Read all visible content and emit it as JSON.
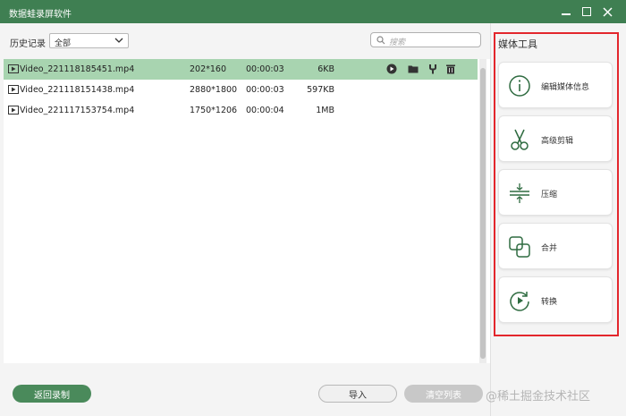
{
  "window": {
    "title": "数据蛙录屏软件"
  },
  "toolbar": {
    "history_label": "历史记录",
    "filter_value": "全部",
    "search_placeholder": "搜索"
  },
  "files": [
    {
      "name": "Video_221118185451.mp4",
      "resolution": "202*160",
      "duration": "00:00:03",
      "size": "6KB",
      "selected": true
    },
    {
      "name": "Video_221118151438.mp4",
      "resolution": "2880*1800",
      "duration": "00:00:03",
      "size": "597KB",
      "selected": false
    },
    {
      "name": "Video_221117153754.mp4",
      "resolution": "1750*1206",
      "duration": "00:00:04",
      "size": "1MB",
      "selected": false
    }
  ],
  "buttons": {
    "back": "返回录制",
    "import": "导入",
    "clear": "清空列表"
  },
  "tools": {
    "title": "媒体工具",
    "items": [
      {
        "label": "编辑媒体信息",
        "icon": "info-icon"
      },
      {
        "label": "高级剪辑",
        "icon": "scissors-icon"
      },
      {
        "label": "压缩",
        "icon": "compress-icon"
      },
      {
        "label": "合并",
        "icon": "merge-icon"
      },
      {
        "label": "转换",
        "icon": "convert-icon"
      }
    ]
  },
  "watermark": "@稀土掘金技术社区",
  "colors": {
    "accent": "#4a8a5b",
    "titlebar": "#3f7f52",
    "selected_row": "#a8d4b0",
    "highlight": "#e3262c"
  }
}
